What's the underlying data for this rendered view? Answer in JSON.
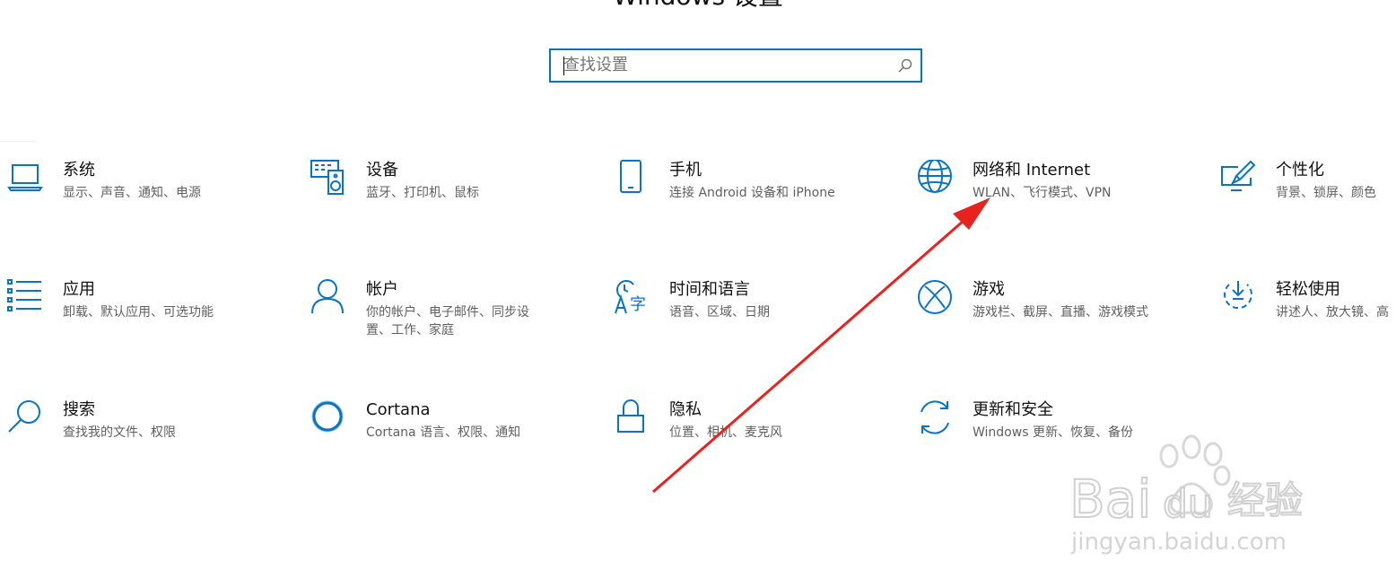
{
  "window": {
    "title": "Windows 设置"
  },
  "search": {
    "placeholder": "查找设置"
  },
  "tiles": [
    {
      "title": "系统",
      "desc": "显示、声音、通知、电源",
      "icon": "laptop-icon"
    },
    {
      "title": "设备",
      "desc": "蓝牙、打印机、鼠标",
      "icon": "devices-icon"
    },
    {
      "title": "手机",
      "desc": "连接 Android 设备和 iPhone",
      "icon": "phone-icon"
    },
    {
      "title": "网络和 Internet",
      "desc": "WLAN、飞行模式、VPN",
      "icon": "globe-icon"
    },
    {
      "title": "个性化",
      "desc": "背景、锁屏、颜色",
      "icon": "personalize-icon"
    },
    {
      "title": "应用",
      "desc": "卸载、默认应用、可选功能",
      "icon": "apps-list-icon"
    },
    {
      "title": "帐户",
      "desc": "你的帐户、电子邮件、同步设置、工作、家庭",
      "icon": "person-icon"
    },
    {
      "title": "时间和语言",
      "desc": "语音、区域、日期",
      "icon": "time-language-icon"
    },
    {
      "title": "游戏",
      "desc": "游戏栏、截屏、直播、游戏模式",
      "icon": "xbox-icon"
    },
    {
      "title": "轻松使用",
      "desc": "讲述人、放大镜、高",
      "icon": "ease-of-access-icon"
    },
    {
      "title": "搜索",
      "desc": "查找我的文件、权限",
      "icon": "search-icon"
    },
    {
      "title": "Cortana",
      "desc": "Cortana 语言、权限、通知",
      "icon": "cortana-icon"
    },
    {
      "title": "隐私",
      "desc": "位置、相机、麦克风",
      "icon": "lock-icon"
    },
    {
      "title": "更新和安全",
      "desc": "Windows 更新、恢复、备份",
      "icon": "sync-icon"
    }
  ],
  "watermark": {
    "brand": "Baidu经验",
    "url": "jingyan.baidu.com"
  },
  "colors": {
    "accent": "#0a74c4",
    "arrow": "#e8231f"
  }
}
